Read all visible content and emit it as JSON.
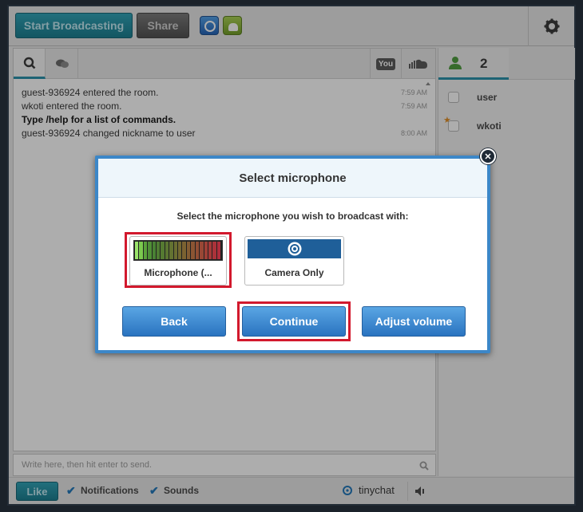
{
  "toolbar": {
    "start_broadcasting": "Start Broadcasting",
    "share": "Share"
  },
  "chat": {
    "messages": [
      {
        "text": "guest-936924 entered the room.",
        "time": "7:59 AM"
      },
      {
        "text": "wkoti entered the room.",
        "time": "7:59 AM"
      },
      {
        "text": "Type /help for a list of commands.",
        "time": ""
      },
      {
        "text": "guest-936924 changed nickname to user",
        "time": "8:00 AM"
      }
    ],
    "input_placeholder": "Write here, then hit enter to send."
  },
  "bottombar": {
    "like": "Like",
    "notifications": "Notifications",
    "sounds": "Sounds",
    "brand": "tinychat"
  },
  "users": {
    "count": "2",
    "list": [
      "user",
      "wkoti"
    ]
  },
  "modal": {
    "title": "Select microphone",
    "instruction": "Select the microphone you wish to broadcast with:",
    "options": {
      "microphone": "Microphone (...",
      "camera_only": "Camera Only"
    },
    "buttons": {
      "back": "Back",
      "continue": "Continue",
      "adjust_volume": "Adjust volume"
    }
  },
  "icons": {
    "settings": "gear-icon",
    "search": "search-icon",
    "speaker": "speaker-icon",
    "close": "close-icon"
  },
  "colors": {
    "accent": "#238ea8",
    "modal_border": "#3c87c8",
    "highlight": "#d2192d"
  }
}
